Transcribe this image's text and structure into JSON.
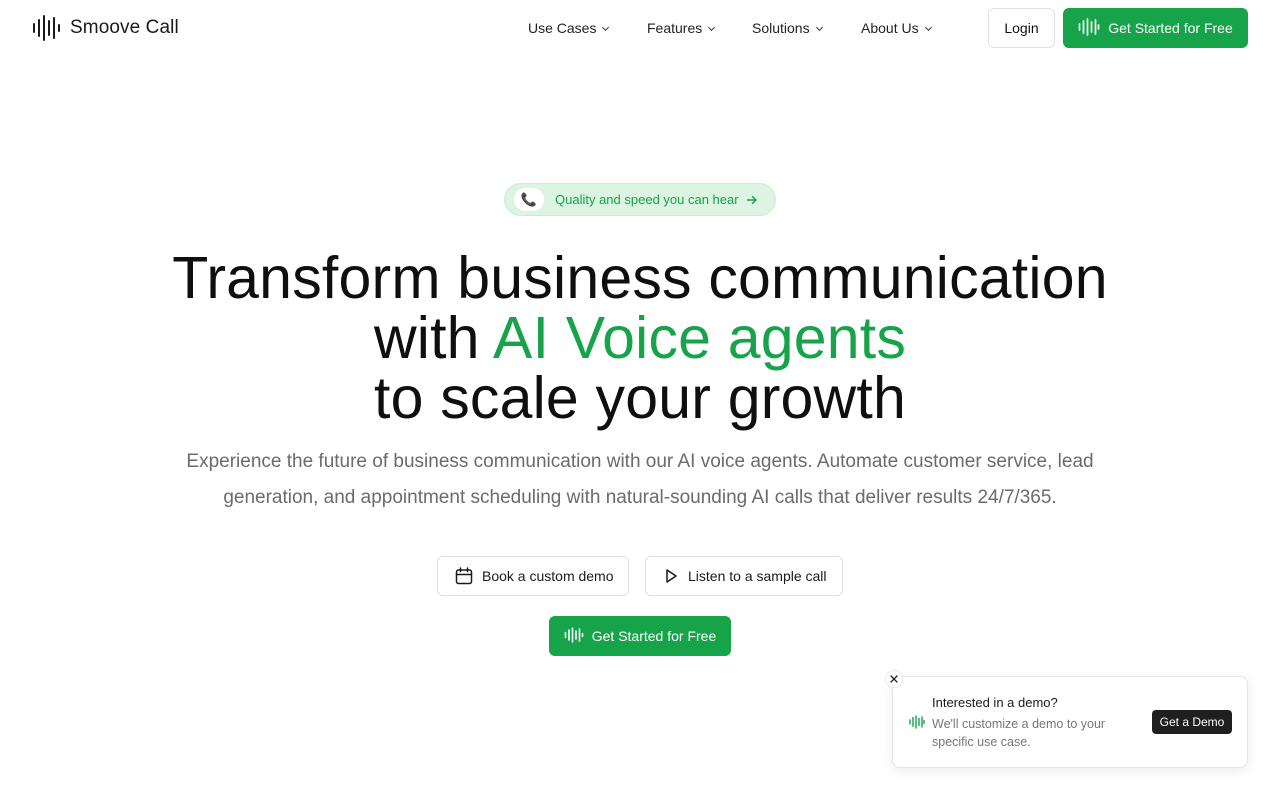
{
  "brand": {
    "name": "Smoove Call",
    "logo_icon": "sound-wave-icon",
    "accent_color": "#16a34a"
  },
  "nav": {
    "items": [
      {
        "label": "Use Cases"
      },
      {
        "label": "Features"
      },
      {
        "label": "Solutions"
      },
      {
        "label": "About Us"
      }
    ],
    "login_label": "Login",
    "cta_label": "Get Started for Free"
  },
  "hero": {
    "badge": {
      "icon": "phone-icon",
      "text": "Quality and speed you can hear"
    },
    "headline": {
      "line1": "Transform business communication",
      "line2_prefix": "with",
      "line2_accent": "AI Voice agents",
      "line3": "to scale your growth"
    },
    "subtitle": "Experience the future of business communication with our AI voice agents. Automate customer service, lead generation, and appointment scheduling with natural-sounding AI calls that deliver results 24/7/365.",
    "demo_label": "Book a custom demo",
    "listen_label": "Listen to a sample call",
    "cta_label": "Get Started for Free"
  },
  "popup": {
    "title": "Interested in a demo?",
    "body": "We'll customize a demo to your specific use case.",
    "button_label": "Get a Demo"
  }
}
